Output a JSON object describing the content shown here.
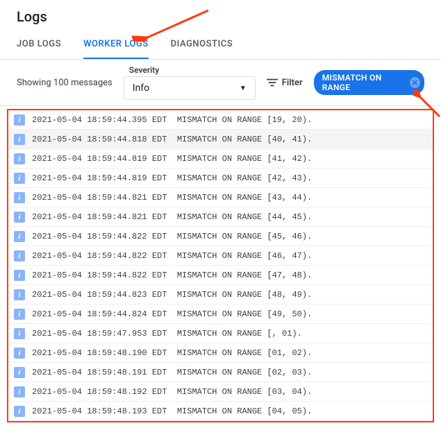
{
  "header": {
    "title": "Logs"
  },
  "tabs": {
    "job": "JOB LOGS",
    "worker": "WORKER LOGS",
    "diagnostics": "DIAGNOSTICS",
    "active": "worker"
  },
  "controls": {
    "showing": "Showing 100 messages",
    "severity_label": "Severity",
    "severity_value": "Info",
    "filter_label": "Filter",
    "chip_label": "MISMATCH ON RANGE"
  },
  "logs": [
    {
      "ts": "2021-05-04 18:59:44.395 EDT",
      "msg": "MISMATCH ON RANGE [19, 20)."
    },
    {
      "ts": "2021-05-04 18:59:44.818 EDT",
      "msg": "MISMATCH ON RANGE [40, 41)."
    },
    {
      "ts": "2021-05-04 18:59:44.819 EDT",
      "msg": "MISMATCH ON RANGE [41, 42)."
    },
    {
      "ts": "2021-05-04 18:59:44.819 EDT",
      "msg": "MISMATCH ON RANGE [42, 43)."
    },
    {
      "ts": "2021-05-04 18:59:44.821 EDT",
      "msg": "MISMATCH ON RANGE [43, 44)."
    },
    {
      "ts": "2021-05-04 18:59:44.821 EDT",
      "msg": "MISMATCH ON RANGE [44, 45)."
    },
    {
      "ts": "2021-05-04 18:59:44.822 EDT",
      "msg": "MISMATCH ON RANGE [45, 46)."
    },
    {
      "ts": "2021-05-04 18:59:44.822 EDT",
      "msg": "MISMATCH ON RANGE [46, 47)."
    },
    {
      "ts": "2021-05-04 18:59:44.822 EDT",
      "msg": "MISMATCH ON RANGE [47, 48)."
    },
    {
      "ts": "2021-05-04 18:59:44.823 EDT",
      "msg": "MISMATCH ON RANGE [48, 49)."
    },
    {
      "ts": "2021-05-04 18:59:44.824 EDT",
      "msg": "MISMATCH ON RANGE [49, 50)."
    },
    {
      "ts": "2021-05-04 18:59:47.953 EDT",
      "msg": "MISMATCH ON RANGE [, 01)."
    },
    {
      "ts": "2021-05-04 18:59:48.190 EDT",
      "msg": "MISMATCH ON RANGE [01, 02)."
    },
    {
      "ts": "2021-05-04 18:59:48.191 EDT",
      "msg": "MISMATCH ON RANGE [02, 03)."
    },
    {
      "ts": "2021-05-04 18:59:48.192 EDT",
      "msg": "MISMATCH ON RANGE [03, 04)."
    },
    {
      "ts": "2021-05-04 18:59:48.193 EDT",
      "msg": "MISMATCH ON RANGE [04, 05)."
    }
  ]
}
